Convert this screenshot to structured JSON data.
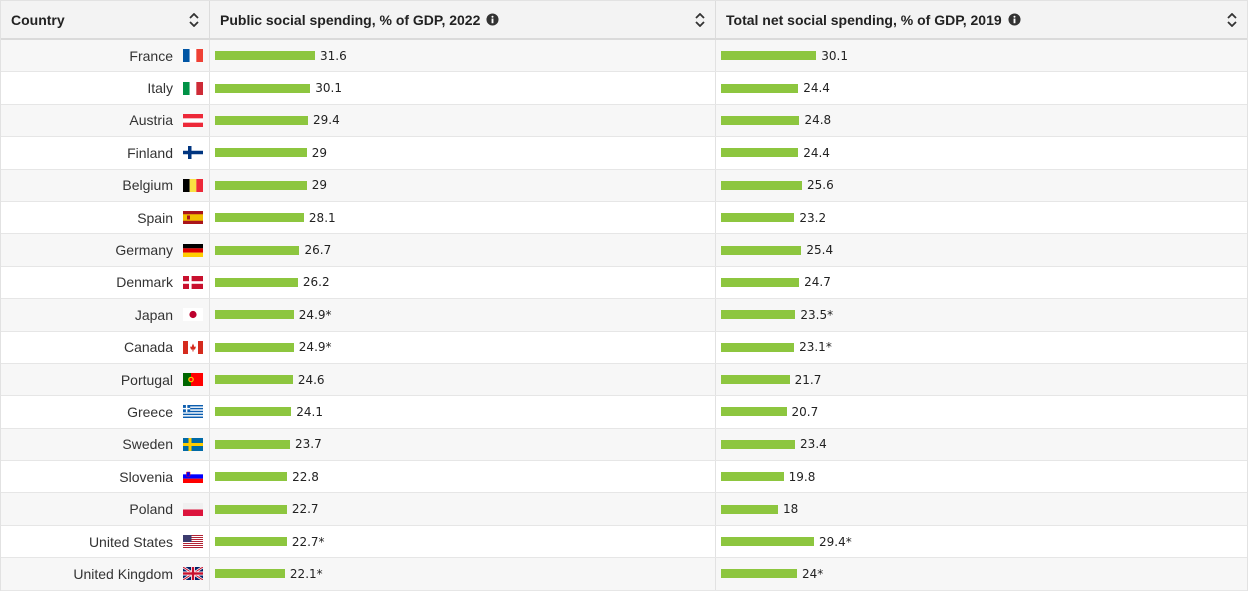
{
  "header": {
    "country": "Country",
    "col1": "Public social spending, % of GDP, 2022",
    "col2": "Total net social spending, % of GDP, 2019"
  },
  "scale_max": 31.6,
  "bar_color": "#8dc63f",
  "rows": [
    {
      "country": "France",
      "flag": "france-flag-icon",
      "v1": 31.6,
      "l1": "31.6",
      "v2": 30.1,
      "l2": "30.1"
    },
    {
      "country": "Italy",
      "flag": "italy-flag-icon",
      "v1": 30.1,
      "l1": "30.1",
      "v2": 24.4,
      "l2": "24.4"
    },
    {
      "country": "Austria",
      "flag": "austria-flag-icon",
      "v1": 29.4,
      "l1": "29.4",
      "v2": 24.8,
      "l2": "24.8"
    },
    {
      "country": "Finland",
      "flag": "finland-flag-icon",
      "v1": 29,
      "l1": "29",
      "v2": 24.4,
      "l2": "24.4"
    },
    {
      "country": "Belgium",
      "flag": "belgium-flag-icon",
      "v1": 29,
      "l1": "29",
      "v2": 25.6,
      "l2": "25.6"
    },
    {
      "country": "Spain",
      "flag": "spain-flag-icon",
      "v1": 28.1,
      "l1": "28.1",
      "v2": 23.2,
      "l2": "23.2"
    },
    {
      "country": "Germany",
      "flag": "germany-flag-icon",
      "v1": 26.7,
      "l1": "26.7",
      "v2": 25.4,
      "l2": "25.4"
    },
    {
      "country": "Denmark",
      "flag": "denmark-flag-icon",
      "v1": 26.2,
      "l1": "26.2",
      "v2": 24.7,
      "l2": "24.7"
    },
    {
      "country": "Japan",
      "flag": "japan-flag-icon",
      "v1": 24.9,
      "l1": "24.9*",
      "v2": 23.5,
      "l2": "23.5*"
    },
    {
      "country": "Canada",
      "flag": "canada-flag-icon",
      "v1": 24.9,
      "l1": "24.9*",
      "v2": 23.1,
      "l2": "23.1*"
    },
    {
      "country": "Portugal",
      "flag": "portugal-flag-icon",
      "v1": 24.6,
      "l1": "24.6",
      "v2": 21.7,
      "l2": "21.7"
    },
    {
      "country": "Greece",
      "flag": "greece-flag-icon",
      "v1": 24.1,
      "l1": "24.1",
      "v2": 20.7,
      "l2": "20.7"
    },
    {
      "country": "Sweden",
      "flag": "sweden-flag-icon",
      "v1": 23.7,
      "l1": "23.7",
      "v2": 23.4,
      "l2": "23.4"
    },
    {
      "country": "Slovenia",
      "flag": "slovenia-flag-icon",
      "v1": 22.8,
      "l1": "22.8",
      "v2": 19.8,
      "l2": "19.8"
    },
    {
      "country": "Poland",
      "flag": "poland-flag-icon",
      "v1": 22.7,
      "l1": "22.7",
      "v2": 18,
      "l2": "18"
    },
    {
      "country": "United States",
      "flag": "usa-flag-icon",
      "v1": 22.7,
      "l1": "22.7*",
      "v2": 29.4,
      "l2": "29.4*"
    },
    {
      "country": "United Kingdom",
      "flag": "uk-flag-icon",
      "v1": 22.1,
      "l1": "22.1*",
      "v2": 24,
      "l2": "24*"
    }
  ]
}
